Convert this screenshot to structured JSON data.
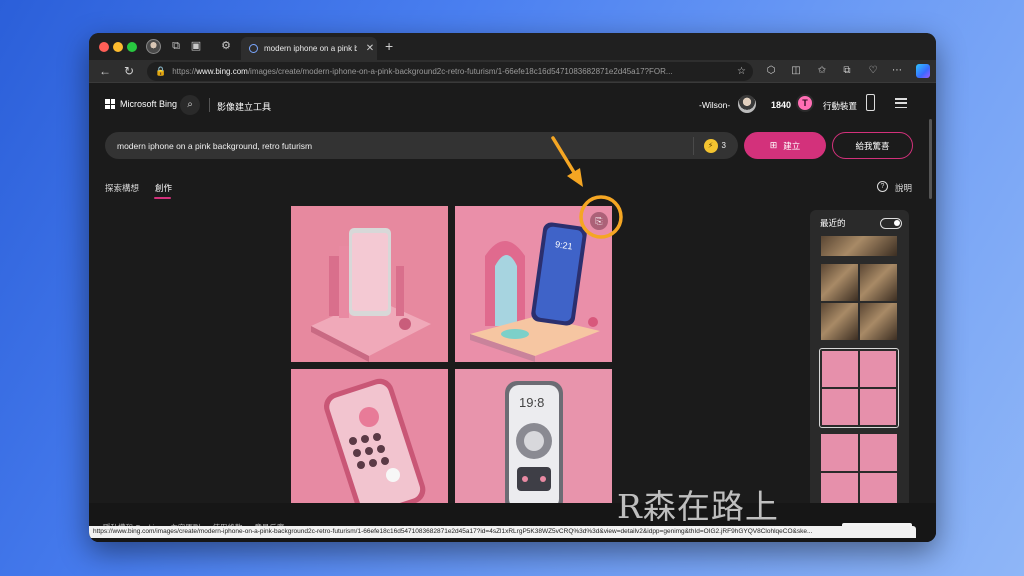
{
  "browser": {
    "tab_title": "modern iphone on a pink backg",
    "url_prefix": "https://",
    "url_domain": "www.bing.com",
    "url_path": "/images/create/modern-iphone-on-a-pink-background2c-retro-futurism/1-66efe18c16d5471083682871e2d45a17?FOR...",
    "status_url": "https://www.bing.com/images/create/modern-iphone-on-a-pink-background2c-retro-futurism/1-66efe18c16d5471083682871e2d45a17?id=4sZl1xRLrgP5K38WZ5vCRQ%3d%3d&view=detailv2&idpp=genimg&thId=OIG2.jRF9hGYQV8ClohlqeCO&ske..."
  },
  "header": {
    "logo_text": "Microsoft Bing",
    "creator_title": "影像建立工具",
    "user_name": "-Wilson-",
    "points": "1840",
    "mobile_label": "行動裝置"
  },
  "prompt": {
    "text": "modern iphone on a pink background, retro futurism",
    "boost_count": "3",
    "create_label": "建立",
    "surprise_label": "給我驚喜"
  },
  "tabs": {
    "explore": "探索構想",
    "create": "創作"
  },
  "help_label": "說明",
  "recent": {
    "label": "最近的"
  },
  "footer": {
    "links": [
      "隱私權和 Cookie",
      "內容原則",
      "使用條款",
      "意見反應"
    ]
  },
  "watermark": "R森在路上",
  "colors": {
    "accent": "#d3317b",
    "annotation": "#f5a623",
    "page_bg": "#1b1b1b"
  }
}
